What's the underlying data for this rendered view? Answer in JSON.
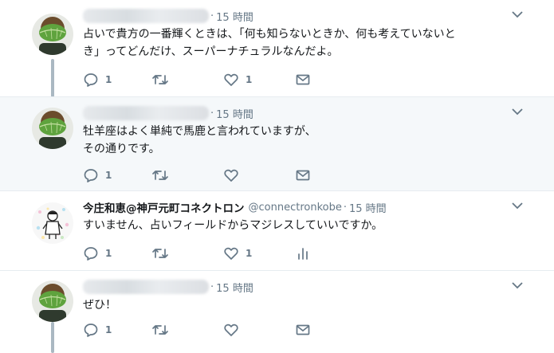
{
  "colors": {
    "accent": "#1da1f2",
    "muted": "#657786",
    "thread_line": "#aab8c2",
    "highlight_bg": "#f5f8fa"
  },
  "tweets": [
    {
      "time": "15 時間",
      "lines": [
        "占いで貴方の一番輝くときは、「何も知らないときか、何も考えていないと",
        "き」ってどんだけ、スーパーナチュラルなんだよ。"
      ],
      "reply_count": "1",
      "like_count": "1"
    },
    {
      "time": "15 時間",
      "lines": [
        "牡羊座はよく単純で馬鹿と言われていますが、",
        "その通りです。"
      ],
      "reply_count": "1",
      "like_count": ""
    },
    {
      "display_name": "今庄和恵@神戸元町コネクトロン",
      "handle": "@connectronkobe",
      "time": "15 時間",
      "lines": [
        "すいません、占いフィールドからマジレスしていいですか。"
      ],
      "reply_count": "1",
      "like_count": "1"
    },
    {
      "time": "15 時間",
      "lines": [
        "ぜひ！"
      ],
      "reply_count": "1",
      "like_count": ""
    }
  ],
  "icons": [
    "reply-icon",
    "retweet-icon",
    "like-icon",
    "message-icon",
    "analytics-icon",
    "chevron-down-icon"
  ],
  "sep": "·"
}
